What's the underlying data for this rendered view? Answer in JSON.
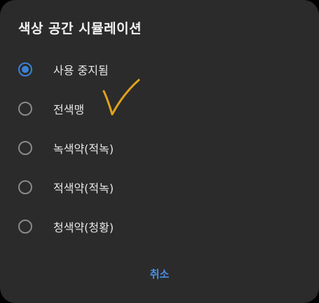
{
  "dialog": {
    "title": "색상 공간 시뮬레이션",
    "options": [
      {
        "label": "사용 중지됨",
        "selected": true
      },
      {
        "label": "전색맹",
        "selected": false
      },
      {
        "label": "녹색약(적녹)",
        "selected": false
      },
      {
        "label": "적색약(적녹)",
        "selected": false
      },
      {
        "label": "청색약(청황)",
        "selected": false
      }
    ],
    "cancel_label": "취소"
  },
  "colors": {
    "background": "#2b2b2b",
    "accent": "#3b82d6",
    "cancel_text": "#4a90e2",
    "annotation": "#e0a21a"
  }
}
